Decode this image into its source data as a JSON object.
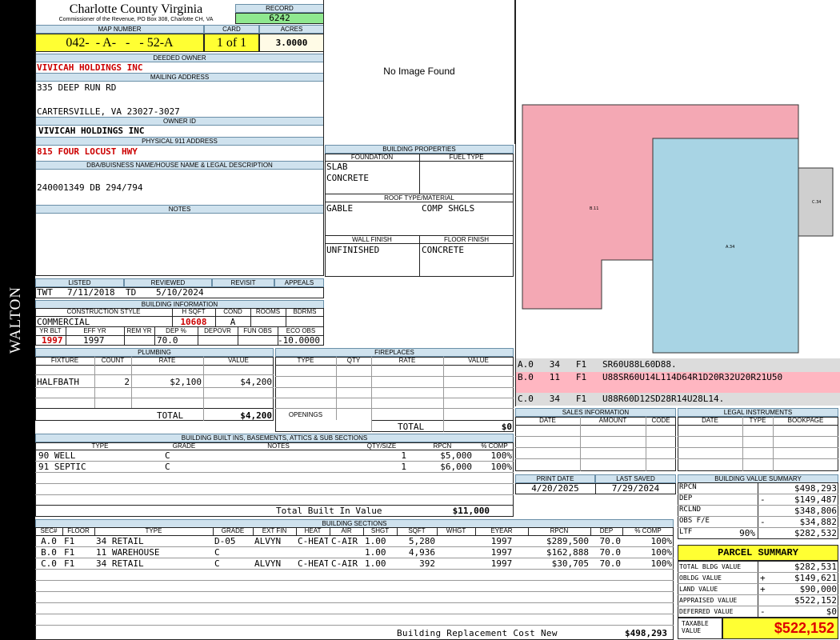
{
  "header": {
    "county": "Charlotte County Virginia",
    "commissioner": "Commissioner of the Revenue, PO Box 308, Charlotte CH, VA",
    "record_label": "RECORD",
    "record": "6242",
    "map_label": "MAP NUMBER",
    "map_number": "042-  - A-   -   - 52-A",
    "card_label": "CARD",
    "card": "1 of 1",
    "acres_label": "ACRES",
    "acres": "3.0000"
  },
  "district": "WALTON",
  "owner": {
    "deeded_label": "DEEDED OWNER",
    "deeded": "VIVICAH HOLDINGS INC",
    "mailing_label": "MAILING ADDRESS",
    "addr1": "335 DEEP RUN RD",
    "addr2": "CARTERSVILLE, VA 23027-3027",
    "owner_id_label": "OWNER ID",
    "owner_id": "VIVICAH HOLDINGS INC",
    "physical_label": "PHYSICAL 911 ADDRESS",
    "physical": "815 FOUR LOCUST HWY",
    "dba_label": "DBA/BUISNESS NAME/HOUSE NAME & LEGAL DESCRIPTION",
    "legal": "240001349 DB 294/794",
    "notes_label": "NOTES"
  },
  "image": {
    "placeholder": "No Image Found"
  },
  "listing": {
    "listed_label": "LISTED",
    "listed_by": "TWT",
    "listed_date": "7/11/2018",
    "reviewed_label": "REVIEWED",
    "reviewed_by": "TD",
    "reviewed_date": "5/10/2024",
    "revisit_label": "REVISIT",
    "appeals_label": "APPEALS"
  },
  "bldg_props": {
    "title": "BUILDING PROPERTIES",
    "foundation_label": "FOUNDATION",
    "foundation1": "SLAB",
    "foundation2": "CONCRETE",
    "fuel_label": "FUEL TYPE",
    "roof_label": "ROOF TYPE/MATERIAL",
    "roof1": "GABLE",
    "roof2": "COMP SHGLS",
    "wall_label": "WALL FINISH",
    "wall": "UNFINISHED",
    "floor_label": "FLOOR FINISH",
    "floor": "CONCRETE"
  },
  "bldg_info": {
    "title": "BUILDING INFORMATION",
    "cs_label": "CONSTRUCTION STYLE",
    "cs": "COMMERCIAL",
    "hsqft_label": "H SQFT",
    "hsqft": "10608",
    "cond_label": "COND",
    "cond": "A",
    "rooms_label": "ROOMS",
    "bdrms_label": "BDRMS",
    "yrblt_label": "YR BLT",
    "yrblt": "1997",
    "effyr_label": "EFF YR",
    "effyr": "1997",
    "remyr_label": "REM YR",
    "dep_label": "DEP %",
    "dep": "70.0",
    "depovr_label": "DEPOVR",
    "funobs_label": "FUN OBS",
    "ecoobs_label": "ECO OBS",
    "ecoobs": "-10.0000"
  },
  "plumbing": {
    "title": "PLUMBING",
    "headers": [
      "FIXTURE",
      "COUNT",
      "RATE",
      "VALUE"
    ],
    "rows": [
      {
        "fixture": "HALFBATH",
        "count": "2",
        "rate": "$2,100",
        "value": "$4,200"
      }
    ],
    "total_label": "TOTAL",
    "total": "$4,200"
  },
  "fireplaces": {
    "title": "FIREPLACES",
    "headers": [
      "TYPE",
      "QTY",
      "RATE",
      "VALUE"
    ],
    "openings_label": "OPENINGS",
    "total_label": "TOTAL",
    "total": "$0"
  },
  "builtins": {
    "title": "BUILDING BUILT INS, BASEMENTS, ATTICS & SUB SECTIONS",
    "headers": [
      "TYPE",
      "GRADE",
      "NOTES",
      "QTY/SIZE",
      "RPCN",
      "% COMP"
    ],
    "rows": [
      {
        "type": "90 WELL",
        "grade": "C",
        "notes": "",
        "qty": "1",
        "rpcn": "$5,000",
        "comp": "100%"
      },
      {
        "type": "91 SEPTIC",
        "grade": "C",
        "notes": "",
        "qty": "1",
        "rpcn": "$6,000",
        "comp": "100%"
      }
    ],
    "total_label": "Total Built In Value",
    "total": "$11,000"
  },
  "sketch": {
    "rows": [
      {
        "text": "A.0   34   F1   SR60U88L60D88.",
        "bg": "#dcdcdc"
      },
      {
        "text": "B.0   11   F1   U88SR60U14L114D64R1D20R32U20R21U50",
        "bg": "#ffb6c1"
      },
      {
        "text": "C.0   34   F1   U88R60D12SD28R14U28L14.",
        "bg": "#dcdcdc"
      }
    ],
    "pink": "#f4a8b4",
    "blue": "#a8d4e4",
    "gray": "#cfcfcf",
    "labels": {
      "b": "B.11",
      "c": "C.34",
      "a": "A.34"
    }
  },
  "sales": {
    "title": "SALES INFORMATION",
    "headers": [
      "DATE",
      "AMOUNT",
      "CODE"
    ]
  },
  "legal": {
    "title": "LEGAL INSTRUMENTS",
    "headers": [
      "DATE",
      "TYPE",
      "BOOKPAGE"
    ]
  },
  "dates": {
    "print_label": "PRINT DATE",
    "print": "4/20/2025",
    "saved_label": "LAST SAVED",
    "saved": "7/29/2024"
  },
  "value_summary": {
    "title": "BUILDING VALUE SUMMARY",
    "rows": [
      {
        "label": "RPCN",
        "sign": "",
        "pct": "",
        "value": "$498,293"
      },
      {
        "label": "DEP",
        "sign": "-",
        "pct": "",
        "value": "$149,487"
      },
      {
        "label": "RCLND",
        "sign": "",
        "pct": "",
        "value": "$348,806"
      },
      {
        "label": "OBS F/E",
        "sign": "-",
        "pct": "",
        "value": "$34,882"
      },
      {
        "label": "LTF",
        "sign": "",
        "pct": "90%",
        "value": "$282,532"
      }
    ]
  },
  "parcel": {
    "title": "PARCEL SUMMARY",
    "rows": [
      {
        "label": "TOTAL BLDG VALUE",
        "sign": "",
        "value": "$282,531"
      },
      {
        "label": "OBLDG VALUE",
        "sign": "+",
        "value": "$149,621"
      },
      {
        "label": "LAND VALUE",
        "sign": "+",
        "value": "$90,000"
      },
      {
        "label": "APPRAISED VALUE",
        "sign": "",
        "value": "$522,152"
      },
      {
        "label": "DEFERRED VALUE",
        "sign": "-",
        "value": "$0"
      }
    ],
    "taxable_label": "TAXABLE VALUE",
    "taxable": "$522,152"
  },
  "sections": {
    "title": "BUILDING SECTIONS",
    "headers": [
      "SEC#",
      "FLOOR",
      "TYPE",
      "GRADE",
      "EXT FIN",
      "HEAT",
      "AIR",
      "SHGT",
      "SQFT",
      "WHGT",
      "EYEAR",
      "RPCN",
      "DEP",
      "% COMP"
    ],
    "rows": [
      {
        "sec": "A.0",
        "floor": "F1",
        "type": "34 RETAIL",
        "grade": "D-05",
        "ext": "ALVYN",
        "heat": "C-HEAT",
        "air": "C-AIR",
        "shgt": "1.00",
        "sqft": "5,280",
        "whgt": "",
        "eyear": "1997",
        "rpcn": "$289,500",
        "dep": "70.0",
        "comp": "100%"
      },
      {
        "sec": "B.0",
        "floor": "F1",
        "type": "11 WAREHOUSE",
        "grade": "C",
        "ext": "",
        "heat": "",
        "air": "",
        "shgt": "1.00",
        "sqft": "4,936",
        "whgt": "",
        "eyear": "1997",
        "rpcn": "$162,888",
        "dep": "70.0",
        "comp": "100%"
      },
      {
        "sec": "C.0",
        "floor": "F1",
        "type": "34 RETAIL",
        "grade": "C",
        "ext": "ALVYN",
        "heat": "C-HEAT",
        "air": "C-AIR",
        "shgt": "1.00",
        "sqft": "392",
        "whgt": "",
        "eyear": "1997",
        "rpcn": "$30,705",
        "dep": "70.0",
        "comp": "100%"
      }
    ],
    "total_label": "Building Replacement Cost New",
    "total": "$498,293"
  }
}
